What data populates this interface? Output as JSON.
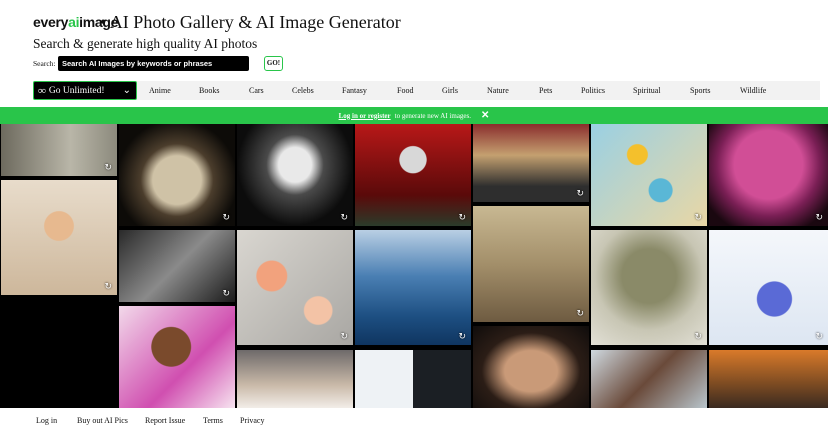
{
  "header": {
    "logo": {
      "part1": "every",
      "part2": "ai",
      "part3": "image"
    },
    "title": "• AI Photo Gallery & AI Image Generator",
    "subtitle": "Search & generate high quality AI photos"
  },
  "search": {
    "label": "Search:",
    "placeholder": "Search AI Images by keywords or phrases",
    "button": "GO!"
  },
  "unlimited": {
    "icon": "∞",
    "label": "Go Unlimited!",
    "chevron": "⌄"
  },
  "categories": [
    "Anime",
    "Books",
    "Cars",
    "Celebs",
    "Fantasy",
    "Food",
    "Girls",
    "Nature",
    "Pets",
    "Politics",
    "Spiritual",
    "Sports",
    "Wildlife"
  ],
  "banner": {
    "link": "Log in or register",
    "text": "to generate new AI images.",
    "close": "✕"
  },
  "regen_icon": "↻",
  "footer": [
    "Log in",
    "Buy out AI Pics",
    "Report Issue",
    "Terms",
    "Privacy"
  ],
  "colors": {
    "accent": "#29c54a",
    "black": "#000000"
  }
}
